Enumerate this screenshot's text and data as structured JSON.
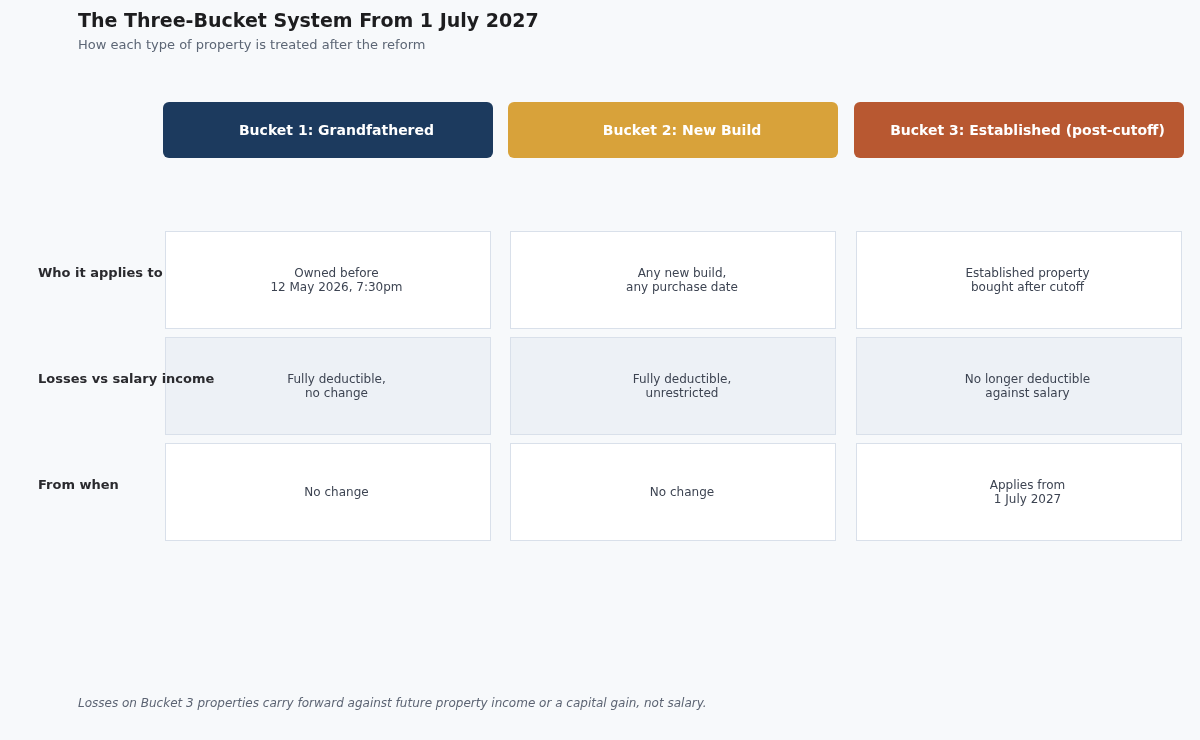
{
  "title": "The Three-Bucket System From 1 July 2027",
  "subtitle": "How each type of property is treated after the reform",
  "buckets": [
    {
      "label": "Bucket 1: Grandfathered",
      "color": "#1c3a5e"
    },
    {
      "label": "Bucket 2: New Build",
      "color": "#d8a23a"
    },
    {
      "label": "Bucket 3: Established (post-cutoff)",
      "color": "#b85831"
    }
  ],
  "rows": [
    {
      "label": "Who it applies to",
      "cells": [
        "Owned before\n12 May 2026, 7:30pm",
        "Any new build,\nany purchase date",
        "Established property\nbought after cutoff"
      ]
    },
    {
      "label": "Losses vs salary income",
      "cells": [
        "Fully deductible,\nno change",
        "Fully deductible,\nunrestricted",
        "No longer deductible\nagainst salary"
      ]
    },
    {
      "label": "From when",
      "cells": [
        "No change",
        "No change",
        "Applies from\n1 July 2027"
      ]
    }
  ],
  "footnote": "Losses on Bucket 3 properties carry forward against future property income or a capital gain, not salary."
}
